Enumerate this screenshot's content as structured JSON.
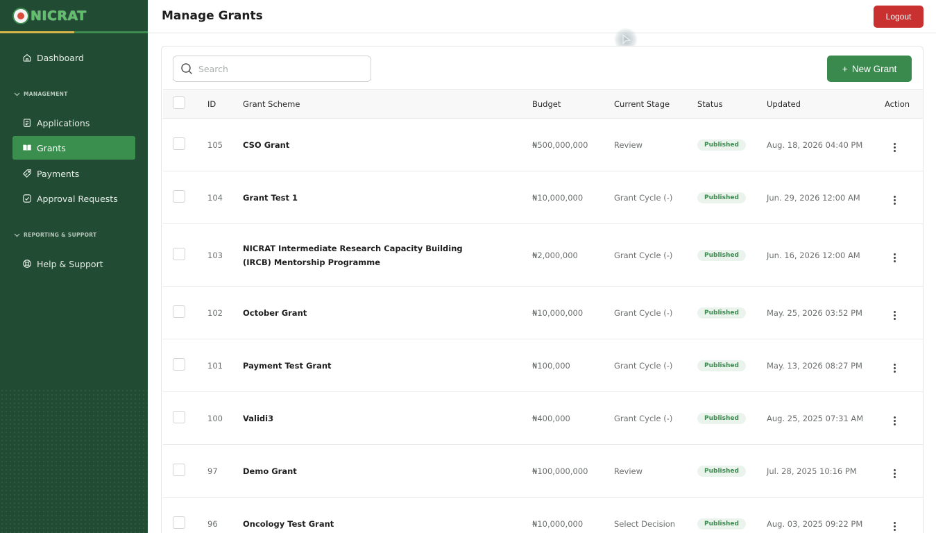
{
  "app": {
    "logo_text": "NICRAT",
    "page_title": "Manage Grants",
    "logout_label": "Logout"
  },
  "sidebar": {
    "dashboard": "Dashboard",
    "management_label": "MANAGEMENT",
    "applications": "Applications",
    "grants": "Grants",
    "payments": "Payments",
    "approval_requests": "Approval Requests",
    "reporting_label": "REPORTING & SUPPORT",
    "help_support": "Help & Support"
  },
  "toolbar": {
    "search_placeholder": "Search",
    "new_grant_label": "New Grant"
  },
  "table": {
    "columns": {
      "id": "ID",
      "scheme": "Grant Scheme",
      "budget": "Budget",
      "stage": "Current Stage",
      "status": "Status",
      "updated": "Updated",
      "action": "Action"
    },
    "rows": [
      {
        "id": "105",
        "scheme": "CSO Grant",
        "budget": "₦500,000,000",
        "stage": "Review",
        "status": "Published",
        "updated": "Aug. 18, 2026 04:40 PM"
      },
      {
        "id": "104",
        "scheme": "Grant Test 1",
        "budget": "₦10,000,000",
        "stage": "Grant Cycle (-)",
        "status": "Published",
        "updated": "Jun. 29, 2026 12:00 AM"
      },
      {
        "id": "103",
        "scheme": "NICRAT Intermediate Research Capacity Building (IRCB) Mentorship Programme",
        "budget": "₦2,000,000",
        "stage": "Grant Cycle (-)",
        "status": "Published",
        "updated": "Jun. 16, 2026 12:00 AM"
      },
      {
        "id": "102",
        "scheme": "October Grant",
        "budget": "₦10,000,000",
        "stage": "Grant Cycle (-)",
        "status": "Published",
        "updated": "May. 25, 2026 03:52 PM"
      },
      {
        "id": "101",
        "scheme": "Payment Test Grant",
        "budget": "₦100,000",
        "stage": "Grant Cycle (-)",
        "status": "Published",
        "updated": "May. 13, 2026 08:27 PM"
      },
      {
        "id": "100",
        "scheme": "Validi3",
        "budget": "₦400,000",
        "stage": "Grant Cycle (-)",
        "status": "Published",
        "updated": "Aug. 25, 2025 07:31 AM"
      },
      {
        "id": "97",
        "scheme": "Demo Grant",
        "budget": "₦100,000,000",
        "stage": "Review",
        "status": "Published",
        "updated": "Jul. 28, 2025 10:16 PM"
      },
      {
        "id": "96",
        "scheme": "Oncology Test Grant",
        "budget": "₦10,000,000",
        "stage": "Select Decision",
        "status": "Published",
        "updated": "Aug. 03, 2025 09:22 PM"
      }
    ]
  },
  "colors": {
    "sidebar_bg": "#214b33",
    "accent_green": "#3a8a4e",
    "logout_red": "#c93030",
    "badge_bg": "#eaf4ec"
  }
}
